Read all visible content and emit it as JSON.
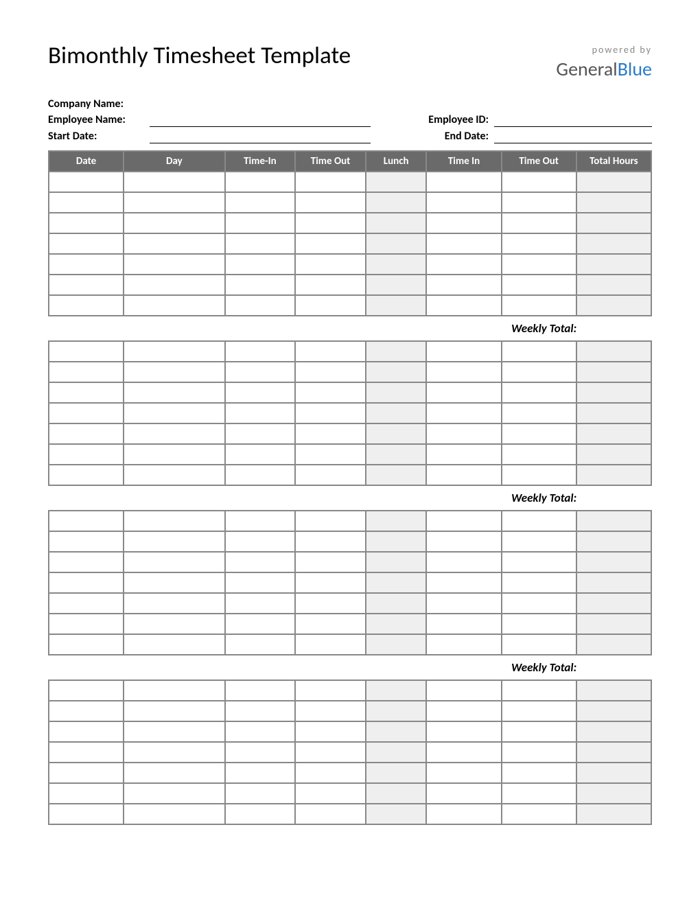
{
  "title": "Bimonthly Timesheet Template",
  "logo": {
    "powered": "powered by",
    "general": "General",
    "blue": "Blue"
  },
  "info": {
    "company_label": "Company Name:",
    "employee_label": "Employee Name:",
    "employee_id_label": "Employee ID:",
    "start_date_label": "Start Date:",
    "end_date_label": "End Date:"
  },
  "columns": {
    "date": "Date",
    "day": "Day",
    "time_in1": "Time-In",
    "time_out1": "Time Out",
    "lunch": "Lunch",
    "time_in2": "Time In",
    "time_out2": "Time Out",
    "total": "Total Hours"
  },
  "weekly_total_label": "Weekly Total:",
  "weeks": [
    {
      "rows": 7
    },
    {
      "rows": 7
    },
    {
      "rows": 7
    },
    {
      "rows": 7
    }
  ]
}
